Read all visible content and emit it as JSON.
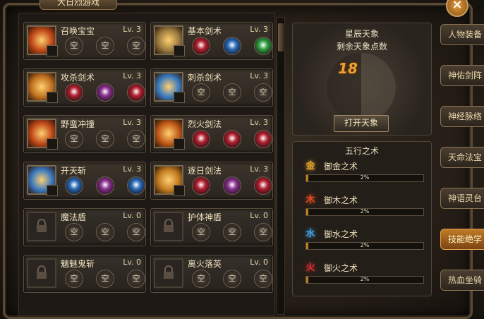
{
  "window": {
    "top_tab": "大日烈游戏"
  },
  "skills": [
    {
      "name": "召唤宝宝",
      "level": "Lv. 3",
      "slots": [
        "空",
        "空",
        "空"
      ],
      "icon": "fire-summon-icon",
      "color": "#c04818"
    },
    {
      "name": "基本剑术",
      "level": "Lv. 3",
      "slots": [
        "gem-red",
        "gem-blue",
        "gem-green"
      ],
      "icon": "sword-slash-icon",
      "color": "#9a7a40"
    },
    {
      "name": "攻杀剑术",
      "level": "Lv. 3",
      "slots": [
        "gem-red",
        "gem-purple",
        "gem-red"
      ],
      "icon": "attack-sword-icon",
      "color": "#c07020"
    },
    {
      "name": "刺杀剑术",
      "level": "Lv. 3",
      "slots": [
        "空",
        "空",
        "空"
      ],
      "icon": "thrust-sword-icon",
      "color": "#3a7ac0"
    },
    {
      "name": "野蛮冲撞",
      "level": "Lv. 3",
      "slots": [
        "空",
        "空",
        "空"
      ],
      "icon": "barbarian-charge-icon",
      "color": "#c04818"
    },
    {
      "name": "烈火剑法",
      "level": "Lv. 3",
      "slots": [
        "gem-red",
        "gem-red",
        "gem-red"
      ],
      "icon": "blaze-sword-icon",
      "color": "#c05a18"
    },
    {
      "name": "开天斩",
      "level": "Lv. 3",
      "slots": [
        "gem-blue",
        "gem-purple",
        "gem-blue"
      ],
      "icon": "sky-slash-icon",
      "color": "#3a78c0"
    },
    {
      "name": "逐日剑法",
      "level": "Lv. 3",
      "slots": [
        "gem-red",
        "gem-purple",
        "gem-red"
      ],
      "icon": "sun-chase-sword-icon",
      "color": "#c07a20"
    },
    {
      "name": "魔法盾",
      "level": "Lv. 0",
      "slots": [
        "空",
        "空",
        "空"
      ],
      "icon": "lock-icon",
      "locked": true
    },
    {
      "name": "护体神盾",
      "level": "Lv. 0",
      "slots": [
        "空",
        "空",
        "空"
      ],
      "icon": "lock-icon",
      "locked": true
    },
    {
      "name": "魑魅鬼斩",
      "level": "Lv. 0",
      "slots": [
        "空",
        "空",
        "空"
      ],
      "icon": "lock-icon",
      "locked": true
    },
    {
      "name": "离火落英",
      "level": "Lv. 0",
      "slots": [
        "空",
        "空",
        "空"
      ],
      "icon": "lock-icon",
      "locked": true
    }
  ],
  "star": {
    "title": "星辰天象",
    "subtitle": "剩余天象点数",
    "points": "18",
    "open_button": "打开天象"
  },
  "wuxing": {
    "title": "五行之术",
    "items": [
      {
        "glyph": "金",
        "name": "御金之术",
        "percent": "2%",
        "fill": 0.02,
        "color": "#e0a030"
      },
      {
        "glyph": "木",
        "name": "御木之术",
        "percent": "2%",
        "fill": 0.02,
        "color": "#e04a20"
      },
      {
        "glyph": "水",
        "name": "御水之术",
        "percent": "2%",
        "fill": 0.02,
        "color": "#40a0e0"
      },
      {
        "glyph": "火",
        "name": "御火之术",
        "percent": "2%",
        "fill": 0.02,
        "color": "#e03030"
      }
    ]
  },
  "side_tabs": [
    {
      "label": "人物装备",
      "active": false
    },
    {
      "label": "神佑剑阵",
      "active": false
    },
    {
      "label": "神经脉络",
      "active": false
    },
    {
      "label": "天命法宝",
      "active": false
    },
    {
      "label": "神语灵台",
      "active": false
    },
    {
      "label": "技能绝学",
      "active": true
    },
    {
      "label": "热血坐骑",
      "active": false
    }
  ],
  "gem_colors": {
    "gem-red": "#b02030",
    "gem-blue": "#2a6ab8",
    "gem-green": "#30a040",
    "gem-purple": "#8a3090"
  }
}
